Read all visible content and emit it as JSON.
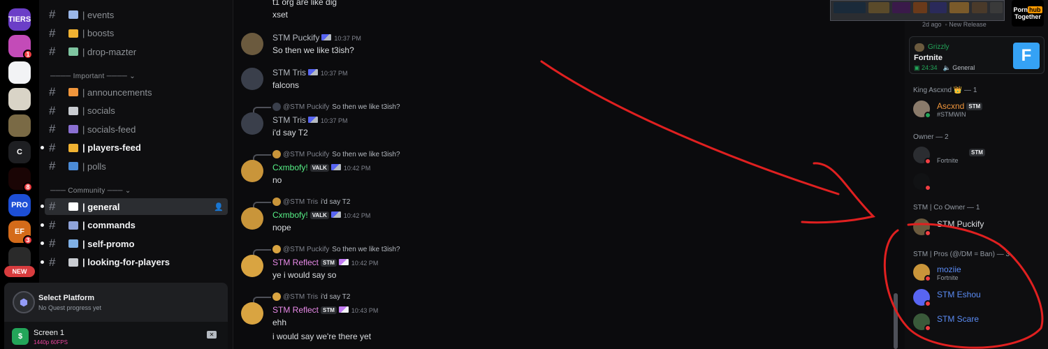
{
  "colors": {
    "accent": "#5865f2",
    "green": "#23a559",
    "red_annotation": "#e02020",
    "pink_role": "#eb459e"
  },
  "servers": [
    {
      "name": "TIERS",
      "label": "TIERS",
      "color": "#6b3ec7",
      "badge": ""
    },
    {
      "name": "Server 2",
      "label": "",
      "color": "#c34bb8",
      "badge": "1"
    },
    {
      "name": "Server 3",
      "label": "",
      "color": "#f2f3f5",
      "badge": ""
    },
    {
      "name": "Server 4",
      "label": "",
      "color": "#d9d4c7",
      "badge": ""
    },
    {
      "name": "Server 5",
      "label": "",
      "color": "#7a6a45",
      "badge": ""
    },
    {
      "name": "C",
      "label": "C",
      "color": "#1e1f22",
      "badge": ""
    },
    {
      "name": "Server 7",
      "label": "",
      "color": "#1a0505",
      "badge": "8"
    },
    {
      "name": "PRO",
      "label": "PRO",
      "color": "#1d4fd6",
      "badge": ""
    },
    {
      "name": "EF",
      "label": "EF",
      "color": "#d46b1a",
      "badge": "3"
    },
    {
      "name": "Server 10",
      "label": "",
      "color": "#2a2a2a",
      "badge": ""
    }
  ],
  "new_badge": "NEW",
  "channels": [
    {
      "name": "| events",
      "bold": false,
      "icon_color": "#9ab7e8"
    },
    {
      "name": "| boosts",
      "bold": false,
      "icon_color": "#f0b232"
    },
    {
      "name": "| drop-mazter",
      "bold": false,
      "icon_color": "#7ec4a0"
    }
  ],
  "category_important": "Important",
  "channels_important": [
    {
      "name": "| announcements",
      "bold": false,
      "icon_color": "#f0963c"
    },
    {
      "name": "| socials",
      "bold": false,
      "icon_color": "#c9ccd1"
    },
    {
      "name": "| socials-feed",
      "bold": false,
      "icon_color": "#8a6fd1"
    },
    {
      "name": "| players-feed",
      "bold": true,
      "icon_color": "#f0b232"
    },
    {
      "name": "| polls",
      "bold": false,
      "icon_color": "#4b8bd6"
    }
  ],
  "category_community": "Community",
  "channels_community": [
    {
      "name": "| general",
      "bold": true,
      "active": true,
      "icon_color": "#ffffff"
    },
    {
      "name": "| commands",
      "bold": true,
      "icon_color": "#8fa3d9"
    },
    {
      "name": "| self-promo",
      "bold": true,
      "icon_color": "#7fb0e6"
    },
    {
      "name": "| looking-for-players",
      "bold": true,
      "icon_color": "#c9ccd1"
    }
  ],
  "quest": {
    "title": "Select Platform",
    "subtitle": "No Quest progress yet"
  },
  "stream": {
    "title": "Screen 1",
    "quality": "1440p 60FPS"
  },
  "chat": {
    "top_lines": [
      "t1 org are like dig",
      "xset"
    ],
    "messages": [
      {
        "author": "STM Puckify",
        "color": "#b5bac1",
        "time": "10:37 PM",
        "text": "So then we like t3ish?",
        "avatar": "#6b5a3e"
      },
      {
        "author": "STM Tris",
        "color": "#b5bac1",
        "time": "10:37 PM",
        "text": "falcons",
        "avatar": "#3a3f4b"
      },
      {
        "reply_to": "@STM Puckify",
        "reply_text": "So then we like t3ish?",
        "author": "STM Tris",
        "color": "#b5bac1",
        "time": "10:37 PM",
        "text": "i'd say T2",
        "avatar": "#3a3f4b"
      },
      {
        "reply_to": "@STM Puckify",
        "reply_text": "So then we like t3ish?",
        "author": "Cxmbofy!",
        "color": "#57f287",
        "tag": "VALK",
        "time": "10:42 PM",
        "text": "no",
        "avatar": "#c9953a"
      },
      {
        "reply_to": "@STM Tris",
        "reply_text": "i'd say T2",
        "author": "Cxmbofy!",
        "color": "#57f287",
        "tag": "VALK",
        "time": "10:42 PM",
        "text": "nope",
        "avatar": "#c9953a"
      },
      {
        "reply_to": "@STM Puckify",
        "reply_text": "So then we like t3ish?",
        "author": "STM Reflect",
        "color": "#e88ae8",
        "tag": "STM",
        "time": "10:42 PM",
        "text": "ye i would say so",
        "avatar": "#d9a441"
      },
      {
        "reply_to": "@STM Tris",
        "reply_text": "i'd say T2",
        "author": "STM Reflect",
        "color": "#e88ae8",
        "tag": "STM",
        "time": "10:43 PM",
        "text": "ehh",
        "text2": "i would say we're there yet",
        "avatar": "#d9a441"
      }
    ]
  },
  "members": {
    "mini_status": "2d ago",
    "mini_release": "New Release",
    "ad_line1": "Porn",
    "ad_hub": "hub",
    "ad_line2": "Together",
    "activity": {
      "name": "Grizzly",
      "game": "Fortnite",
      "duration": "24:34",
      "channel": "General"
    },
    "sections": [
      {
        "title": "King Ascxnd 👑 — 1"
      },
      {
        "title": "Owner — 2"
      },
      {
        "title": "STM | Co Owner — 1"
      },
      {
        "title": "STM | Pros (@/DM = Ban) — 3"
      }
    ],
    "list": [
      {
        "name": "Ascxnd",
        "color": "#f0963c",
        "tag": "STM",
        "status": "#STMWIN",
        "online": true,
        "avatar": "#8a7a6a"
      },
      {
        "name": "",
        "color": "#dbdee1",
        "tag": "STM",
        "status": "Fortnite",
        "online": false,
        "avatar": "#2b2d31"
      },
      {
        "name": "",
        "color": "#dbdee1",
        "tag": "",
        "status": "",
        "online": false,
        "avatar": "#111214"
      },
      {
        "name": "STM Puckify",
        "color": "#dbdee1",
        "tag": "",
        "status": "",
        "online": false,
        "avatar": "#6b5a3e"
      },
      {
        "name": "moziie",
        "color": "#5b8cf5",
        "tag": "",
        "status": "Fortnite",
        "online": false,
        "avatar": "#c9953a"
      },
      {
        "name": "STM Eshou",
        "color": "#5b8cf5",
        "tag": "",
        "status": "",
        "online": false,
        "avatar": "#5865f2"
      },
      {
        "name": "STM Scare",
        "color": "#5b8cf5",
        "tag": "",
        "status": "",
        "online": false,
        "avatar": "#3a5a3a"
      }
    ]
  }
}
